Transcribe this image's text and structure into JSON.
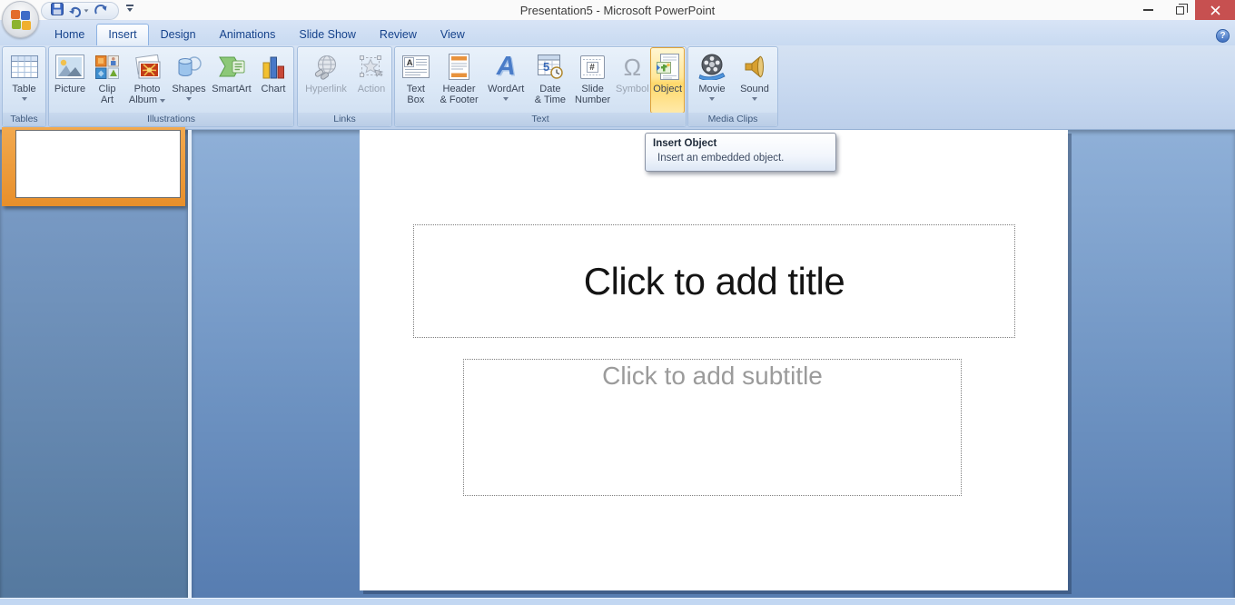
{
  "window": {
    "title": "Presentation5 - Microsoft PowerPoint"
  },
  "tabs": [
    {
      "label": "Home"
    },
    {
      "label": "Insert"
    },
    {
      "label": "Design"
    },
    {
      "label": "Animations"
    },
    {
      "label": "Slide Show"
    },
    {
      "label": "Review"
    },
    {
      "label": "View"
    }
  ],
  "ribbon": {
    "groups": [
      {
        "label": "Tables",
        "buttons": [
          {
            "lines": [
              "Table"
            ]
          }
        ]
      },
      {
        "label": "Illustrations",
        "buttons": [
          {
            "lines": [
              "Picture"
            ]
          },
          {
            "lines": [
              "Clip",
              "Art"
            ]
          },
          {
            "lines": [
              "Photo",
              "Album"
            ]
          },
          {
            "lines": [
              "Shapes"
            ]
          },
          {
            "lines": [
              "SmartArt"
            ]
          },
          {
            "lines": [
              "Chart"
            ]
          }
        ]
      },
      {
        "label": "Links",
        "buttons": [
          {
            "lines": [
              "Hyperlink"
            ]
          },
          {
            "lines": [
              "Action"
            ]
          }
        ]
      },
      {
        "label": "Text",
        "buttons": [
          {
            "lines": [
              "Text",
              "Box"
            ]
          },
          {
            "lines": [
              "Header",
              "& Footer"
            ]
          },
          {
            "lines": [
              "WordArt"
            ]
          },
          {
            "lines": [
              "Date",
              "& Time"
            ]
          },
          {
            "lines": [
              "Slide",
              "Number"
            ]
          },
          {
            "lines": [
              "Symbol"
            ]
          },
          {
            "lines": [
              "Object"
            ]
          }
        ]
      },
      {
        "label": "Media Clips",
        "buttons": [
          {
            "lines": [
              "Movie"
            ]
          },
          {
            "lines": [
              "Sound"
            ]
          }
        ]
      }
    ]
  },
  "tooltip": {
    "title": "Insert Object",
    "description": "Insert an embedded object."
  },
  "slide": {
    "title_placeholder": "Click to add title",
    "subtitle_placeholder": "Click to add subtitle"
  },
  "glyphs": {
    "help": "?",
    "textbox_a": "A",
    "wordart_a": "A",
    "omega": "Ω",
    "hash": "#",
    "calendar_five": "5"
  },
  "colors": {
    "accent_orange": "#F29536",
    "highlight_yellow": "#FFD96B",
    "close_red": "#C75050",
    "tab_text_blue": "#15428B",
    "workspace_blue": "#6E93C2"
  }
}
